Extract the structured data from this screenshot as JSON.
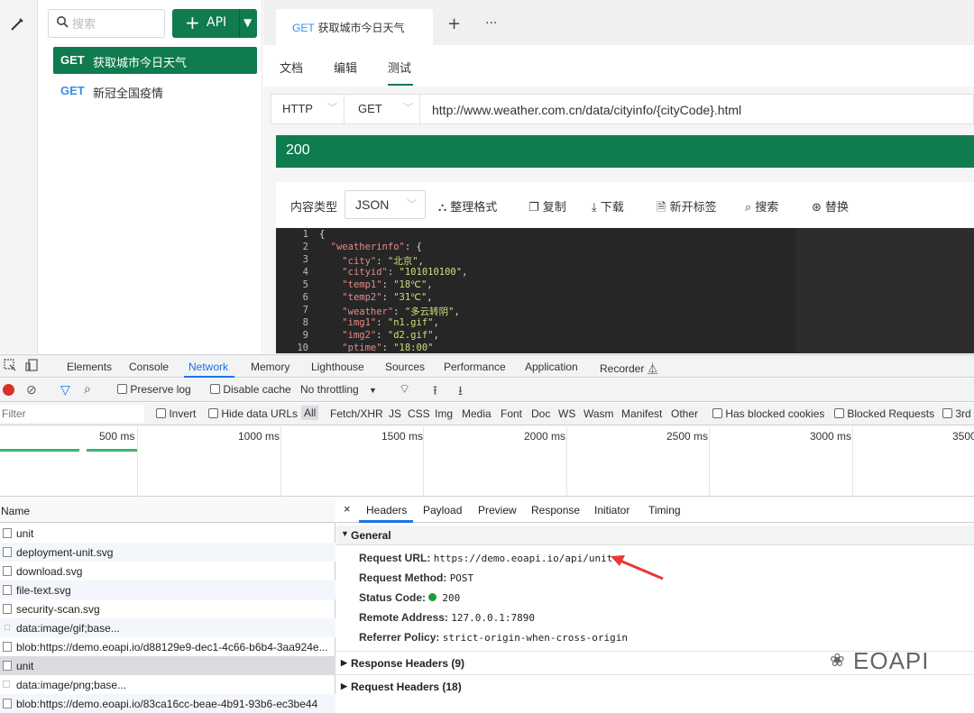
{
  "app": {
    "search_placeholder": "搜索",
    "add_button": "API",
    "apis": [
      {
        "method": "GET",
        "name": "获取城市今日天气"
      },
      {
        "method": "GET",
        "name": "新冠全国疫情"
      }
    ],
    "tab": {
      "method": "GET",
      "name": "获取城市今日天气"
    },
    "subtabs": [
      "文档",
      "编辑",
      "测试"
    ],
    "request": {
      "protocol": "HTTP",
      "method": "GET",
      "url": "http://www.weather.com.cn/data/cityinfo/{cityCode}.html"
    },
    "status_code": "200",
    "response_toolbar": {
      "content_type_label": "内容类型",
      "content_type": "JSON",
      "format": "整理格式",
      "copy": "复制",
      "download": "下载",
      "new_tab": "新开标签",
      "search": "搜索",
      "replace": "替换"
    },
    "code_lines": [
      "1",
      "2",
      "3",
      "4",
      "5",
      "6",
      "7",
      "8",
      "9",
      "10"
    ]
  },
  "devtools": {
    "tabs": [
      "Elements",
      "Console",
      "Network",
      "Memory",
      "Lighthouse",
      "Sources",
      "Performance",
      "Application",
      "Recorder"
    ],
    "active_tab": "Network",
    "toolbar": {
      "preserve_log": "Preserve log",
      "disable_cache": "Disable cache",
      "throttling": "No throttling"
    },
    "filter": {
      "placeholder": "Filter",
      "invert": "Invert",
      "hide_data": "Hide data URLs",
      "types": [
        "All",
        "Fetch/XHR",
        "JS",
        "CSS",
        "Img",
        "Media",
        "Font",
        "Doc",
        "WS",
        "Wasm",
        "Manifest",
        "Other"
      ],
      "blocked_cookies": "Has blocked cookies",
      "blocked_requests": "Blocked Requests",
      "third": "3rd"
    },
    "timeline_ticks": [
      "500 ms",
      "1000 ms",
      "1500 ms",
      "2000 ms",
      "2500 ms",
      "3000 ms",
      "3500"
    ],
    "name_header": "Name",
    "requests": [
      "unit",
      "deployment-unit.svg",
      "download.svg",
      "file-text.svg",
      "security-scan.svg",
      "data:image/gif;base...",
      "blob:https://demo.eoapi.io/d88129e9-dec1-4c66-b6b4-3aa924e...",
      "unit",
      "data:image/png;base...",
      "blob:https://demo.eoapi.io/83ca16cc-beae-4b91-93b6-ec3be44"
    ],
    "detail_tabs": [
      "Headers",
      "Payload",
      "Preview",
      "Response",
      "Initiator",
      "Timing"
    ],
    "general_label": "General",
    "general": [
      {
        "k": "Request URL:",
        "v": "https://demo.eoapi.io/api/unit"
      },
      {
        "k": "Request Method:",
        "v": "POST"
      },
      {
        "k": "Status Code:",
        "v": "200"
      },
      {
        "k": "Remote Address:",
        "v": "127.0.0.1:7890"
      },
      {
        "k": "Referrer Policy:",
        "v": "strict-origin-when-cross-origin"
      }
    ],
    "response_headers": "Response Headers (9)",
    "request_headers": "Request Headers (18)"
  },
  "watermark": "EOAPI",
  "colors": {
    "brand_green": "#0f7b4f",
    "get_blue": "#3a8ee6",
    "active_blue": "#1a73e8",
    "arrow_red": "#e53935"
  }
}
